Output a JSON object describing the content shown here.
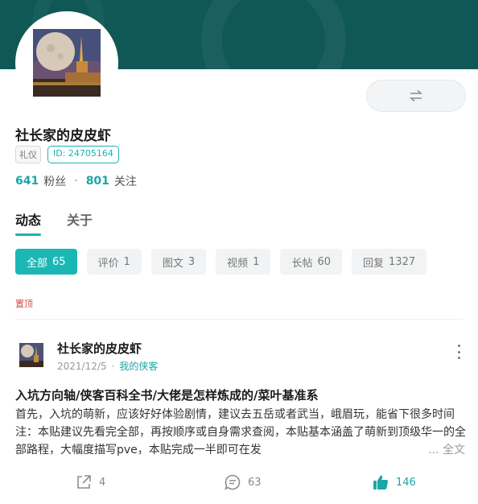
{
  "profile": {
    "username": "社长家的皮皮虾",
    "tag": "礼仪",
    "id_label": "ID: 24705164",
    "fans_count": "641",
    "fans_label": "粉丝",
    "following_count": "801",
    "following_label": "关注",
    "separator": "·"
  },
  "tabs": [
    {
      "label": "动态",
      "active": true
    },
    {
      "label": "关于",
      "active": false
    }
  ],
  "filters": [
    {
      "label": "全部",
      "count": "65",
      "active": true
    },
    {
      "label": "评价",
      "count": "1",
      "active": false
    },
    {
      "label": "图文",
      "count": "3",
      "active": false
    },
    {
      "label": "视频",
      "count": "1",
      "active": false
    },
    {
      "label": "长帖",
      "count": "60",
      "active": false
    },
    {
      "label": "回复",
      "count": "1327",
      "active": false
    }
  ],
  "pinned_label": "置顶",
  "post": {
    "author": "社长家的皮皮虾",
    "date": "2021/12/5",
    "meta_sep": "·",
    "forum": "我的侠客",
    "title": "入坑方向轴/侠客百科全书/大佬是怎样炼成的/菜叶基准系",
    "body": "首先，入坑的萌新，应该好好体验剧情，建议去五岳或者武当，峨眉玩，能省下很多时间 注：本贴建议先看完全部，再按顺序或自身需求查阅，本贴基本涵盖了萌新到顶级华一的全部路程，大幅度描写pve，本贴完成一半即可在发",
    "fulltext_label": "... 全文",
    "share_count": "4",
    "comment_count": "63",
    "like_count": "146"
  },
  "icons": {
    "switch": "swap-arrows-icon",
    "share": "share-icon",
    "comment": "comment-icon",
    "like": "thumbs-up-icon",
    "more": "more-vertical-icon"
  },
  "colors": {
    "banner": "#0f5856",
    "accent": "#1bb7b5",
    "pinned": "#d64a4a"
  }
}
